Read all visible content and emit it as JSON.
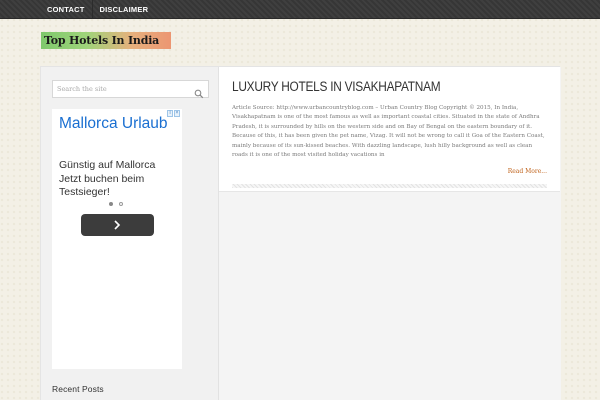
{
  "nav": {
    "items": [
      "CONTACT",
      "DISCLAIMER"
    ]
  },
  "logo": {
    "text": "Top Hotels In India"
  },
  "sidebar": {
    "search_placeholder": "Search the site",
    "ad": {
      "headline": "Mallorca Urlaub",
      "body": "Günstig auf Mallorca Jetzt buchen beim Testsieger!",
      "slide_count": 2,
      "active_slide": 1
    },
    "recent_posts_title": "Recent Posts"
  },
  "post": {
    "title": "LUXURY HOTELS IN VISAKHAPATNAM",
    "excerpt": "Article Source: http://www.urbancountryblog.com – Urban Country Blog Copyright © 2015, In India, Visakhapatnam is one of the most famous as well as important coastal cities. Situated in the state of Andhra Pradesh, it is surrounded by hills on the western side and on Bay of Bengal on the eastern boundary of it. Because of this, it has been given the pet name, Vizag. It will not be wrong to call it Goa of the Eastern Coast, mainly because of its sun-kissed beaches. With dazzling landscape, lush hilly background as well as clean roads it is one of the most visited holiday vacations in",
    "read_more": "Read More..."
  },
  "colors": {
    "accent_link": "#c0631c",
    "ad_headline": "#1a6fd1",
    "topbar": "#3a3a3a"
  }
}
